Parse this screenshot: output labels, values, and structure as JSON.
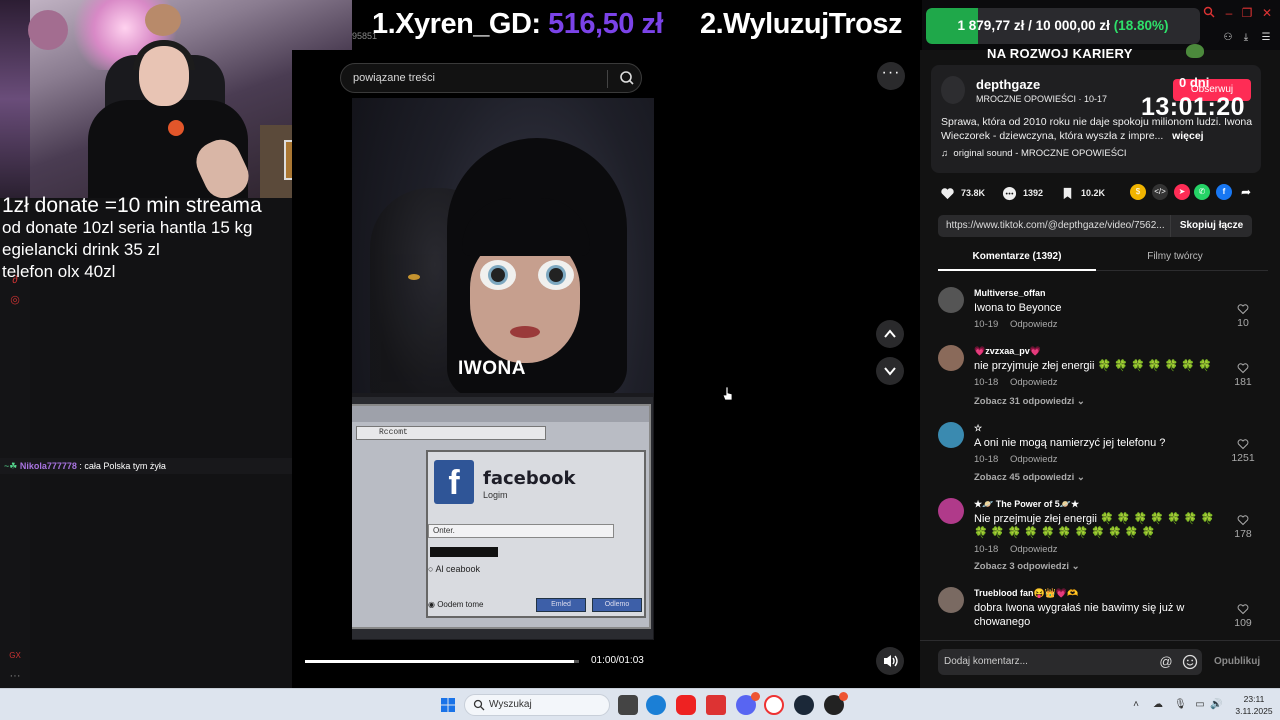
{
  "stream": {
    "donate_lines": [
      "1zł donate =10 min streama",
      "od donate 10zl seria hantla 15 kg",
      "egielancki drink 35 zl",
      "telefon olx 40zl"
    ],
    "chat": {
      "badge": "~☘",
      "user": "Nikola777778",
      "message": ": cała Polska tym żyła"
    },
    "banner": {
      "first_rank": "1.Xyren_GD: ",
      "first_amount": "516,50 zł",
      "second_rank": "2.WyluzujTrosz",
      "tiny_text": "95851"
    },
    "goal": {
      "current": "1 879,77 zł",
      "separator": " / ",
      "target": "10 000,00 zł",
      "percent": "(18.80%)",
      "fraction": 0.188
    },
    "header_label": "NA ROZWOJ KARIERY",
    "timer_days": "0 dni",
    "timer": "13:01:20"
  },
  "search": {
    "placeholder": "powiązane treści"
  },
  "video": {
    "title_overlay": "IWONA",
    "browser_address": "Rccomt",
    "fb_title": "facebook",
    "fb_sub": "Logim",
    "fb_input": "Onter.",
    "fb_radio": "Al ceabook",
    "fb_footer": "Oodem tome",
    "fb_btn1": "Emled",
    "fb_btn2": "Odlemo",
    "time": "01:00/01:03",
    "progress": 0.98
  },
  "post": {
    "username": "depthgaze",
    "meta": "MROCZNE OPOWIEŚCI · 10-17",
    "follow": "Obserwuj",
    "description": "Sprawa, która od 2010 roku nie daje spokoju milionom ludzi. Iwona Wieczorek - dziewczyna, która wyszła z impre...",
    "more": "więcej",
    "sound": "original sound - MROCZNE OPOWIEŚCI",
    "likes": "73.8K",
    "comments_count": "1392",
    "saves": "10.2K",
    "url": "https://www.tiktok.com/@depthgaze/video/7562...",
    "copy_link": "Skopiuj łącze"
  },
  "tabs": {
    "comments": "Komentarze (1392)",
    "creator_videos": "Filmy twórcy"
  },
  "comments": [
    {
      "user": "Multiverse_offan",
      "text": "Iwona to Beyonce",
      "date": "10-19",
      "reply": "Odpowiedz",
      "likes": "10",
      "more": ""
    },
    {
      "user": "💗zvzxaa_pv💗",
      "text": "nie przyjmuje złej energii 🍀 🍀 🍀 🍀 🍀 🍀 🍀",
      "date": "10-18",
      "reply": "Odpowiedz",
      "likes": "181",
      "more": "Zobacz 31 odpowiedzi ⌄"
    },
    {
      "user": "☆",
      "text": "A oni nie mogą namierzyć jej telefonu ?",
      "date": "10-18",
      "reply": "Odpowiedz",
      "likes": "1251",
      "more": "Zobacz 45 odpowiedzi ⌄"
    },
    {
      "user": "★🪐 The Power of 5🪐★",
      "text": "Nie przejmuje złej energii 🍀 🍀 🍀 🍀 🍀 🍀 🍀 🍀 🍀 🍀 🍀 🍀 🍀 🍀 🍀 🍀 🍀 🍀",
      "date": "10-18",
      "reply": "Odpowiedz",
      "likes": "178",
      "more": "Zobacz 3 odpowiedzi ⌄"
    },
    {
      "user": "Trueblood fan😝👑💗🫶",
      "text": "dobra Iwona wygrałaś nie bawimy się już w chowanego",
      "date": "",
      "reply": "",
      "likes": "109",
      "more": ""
    }
  ],
  "comment_box": {
    "placeholder": "Dodaj komentarz...",
    "post": "Opublikuj"
  },
  "taskbar": {
    "search": "Wyszukaj",
    "time": "23:11",
    "date": "3.11.2025"
  },
  "colors": {
    "accent": "#fe2c55",
    "banner_amount": "#7b43e8",
    "goal_fill": "#1fa84a",
    "goal_pct": "#2ee06a"
  }
}
